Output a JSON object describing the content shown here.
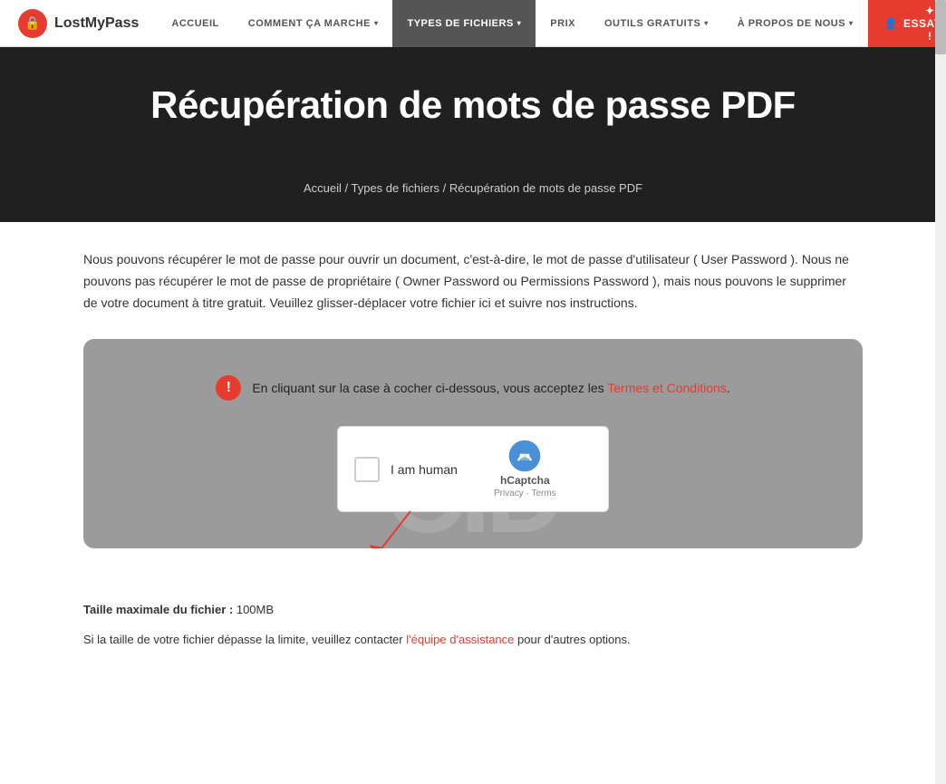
{
  "logo": {
    "icon": "🔒",
    "name": "LostMyPass"
  },
  "nav": {
    "items": [
      {
        "label": "ACCUEIL",
        "has_chevron": false,
        "active": false
      },
      {
        "label": "COMMENT ÇA MARCHE",
        "has_chevron": true,
        "active": false
      },
      {
        "label": "TYPES DE FICHIERS",
        "has_chevron": true,
        "active": true
      },
      {
        "label": "PRIX",
        "has_chevron": false,
        "active": false
      },
      {
        "label": "OUTILS GRATUITS",
        "has_chevron": true,
        "active": false
      },
      {
        "label": "À PROPOS DE NOUS",
        "has_chevron": true,
        "active": false
      }
    ],
    "cta_label": "✦ ESSAYEZ !",
    "cta_icon": "person-icon"
  },
  "hero": {
    "title": "Récupération de mots de passe PDF",
    "breadcrumb": {
      "home": "Accueil",
      "separator1": " / ",
      "types": "Types de fichiers",
      "separator2": " / ",
      "current": "Récupération de mots de passe PDF"
    }
  },
  "intro": {
    "text": "Nous pouvons récupérer le mot de passe pour ouvrir un document, c'est-à-dire, le mot de passe d'utilisateur ( User Password ). Nous ne pouvons pas récupérer le mot de passe de propriétaire ( Owner Password ou Permissions Password ), mais nous pouvons le supprimer de votre document à titre gratuit. Veuillez glisser-déplacer votre fichier ici et suivre nos instructions."
  },
  "upload_box": {
    "watermark": "CID",
    "alert_text": "En cliquant sur la case à cocher ci-dessous, vous acceptez les ",
    "alert_link_text": "Termes et Conditions",
    "alert_link_suffix": ".",
    "captcha": {
      "label": "I am human",
      "brand_name": "hCaptcha",
      "privacy_text": "Privacy",
      "separator": " · ",
      "terms_text": "Terms"
    }
  },
  "footer_info": {
    "max_size_label": "Taille maximale du fichier :",
    "max_size_value": "100MB",
    "contact_text": "Si la taille de votre fichier dépasse la limite, veuillez contacter ",
    "contact_link_text": "l'équipe d'assistance",
    "contact_suffix": " pour d'autres options."
  }
}
